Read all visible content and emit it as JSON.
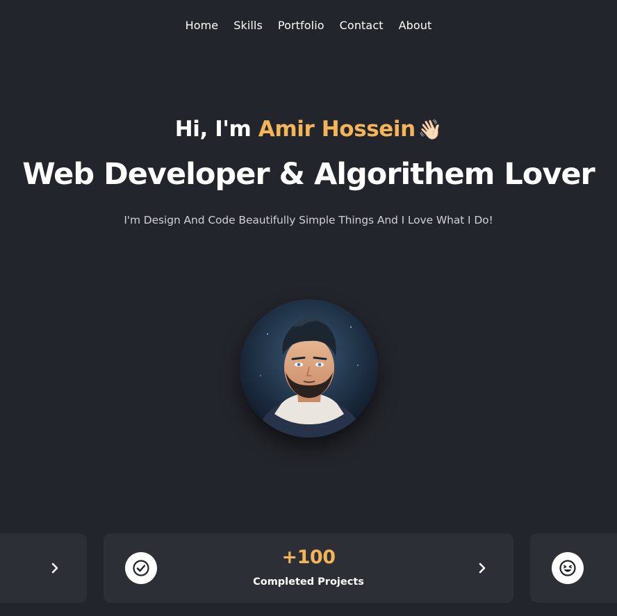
{
  "nav": {
    "items": [
      "Home",
      "Skills",
      "Portfolio",
      "Contact",
      "About"
    ]
  },
  "hero": {
    "greeting_prefix": "Hi, I'm ",
    "name": "Amir Hossein",
    "wave": "👋🏻",
    "headline": "Web Developer & Algorithem Lover",
    "tagline": "I'm Design And Code Beautifully Simple Things And I Love What I Do!"
  },
  "profile": {
    "avatar_icon": "profile-photo"
  },
  "stats": {
    "current": {
      "value": "+100",
      "label": "Completed Projects",
      "icon": "check-circle-icon"
    },
    "next_icon": "laughing-face-icon"
  },
  "colors": {
    "background": "#22252b",
    "card": "#2c2f35",
    "accent": "#f4b45a",
    "text": "#ffffff",
    "muted": "#d0d2d6"
  }
}
